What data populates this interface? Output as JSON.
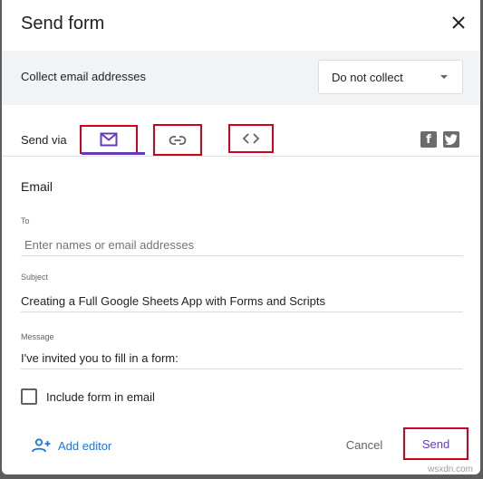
{
  "dialog": {
    "title": "Send form"
  },
  "collect": {
    "label": "Collect email addresses",
    "selected": "Do not collect"
  },
  "send_via": {
    "label": "Send via",
    "tabs": [
      {
        "id": "email",
        "icon": "envelope-icon",
        "active": true
      },
      {
        "id": "link",
        "icon": "link-icon",
        "active": false
      },
      {
        "id": "embed",
        "icon": "code-brackets-icon",
        "active": false
      }
    ],
    "social": [
      {
        "id": "facebook",
        "icon": "facebook-icon",
        "glyph": "f"
      },
      {
        "id": "twitter",
        "icon": "twitter-icon",
        "glyph": "🐦"
      }
    ]
  },
  "email": {
    "section_title": "Email",
    "to_label": "To",
    "to_placeholder": "Enter names or email addresses",
    "to_value": "",
    "subject_label": "Subject",
    "subject_value": "Creating a Full Google Sheets App with Forms and Scripts",
    "message_label": "Message",
    "message_value": "I've invited you to fill in a form:",
    "include_form_label": "Include form in email",
    "include_form_checked": false
  },
  "footer": {
    "add_editor_label": "Add editor",
    "cancel_label": "Cancel",
    "send_label": "Send"
  },
  "watermark": "wsxdn.com",
  "colors": {
    "accent": "#673ab7",
    "link": "#1a73e8",
    "highlight_box": "#d0021b",
    "band": "#f1f3f4"
  }
}
